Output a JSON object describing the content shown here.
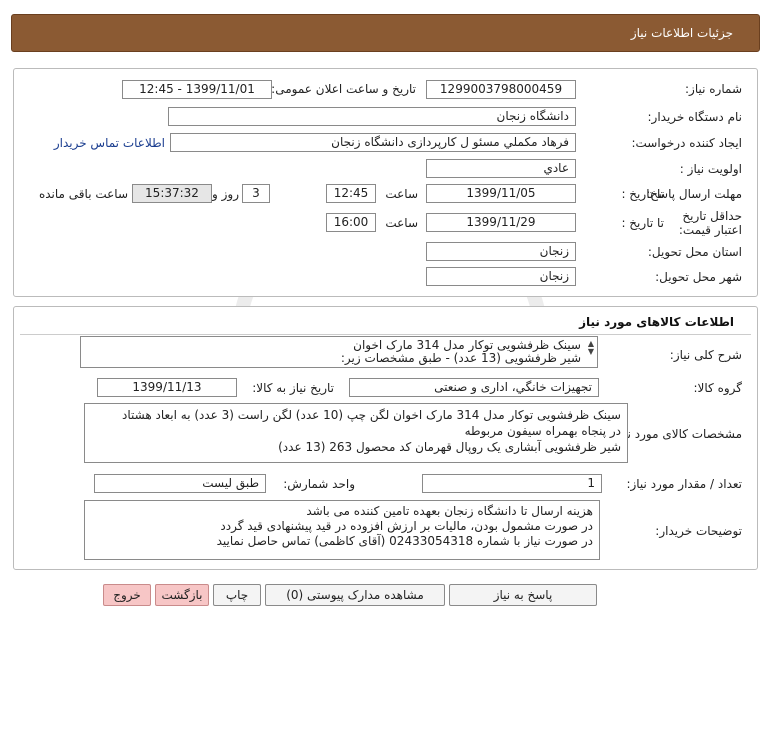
{
  "header": {
    "title": "جزئیات اطلاعات نیاز"
  },
  "info": {
    "need_number_label": "شماره نیاز:",
    "need_number": "1299003798000459",
    "announce_label": "تاریخ و ساعت اعلان عمومی:",
    "announce_value": "1399/11/01 - 12:45",
    "buyer_org_label": "نام دستگاه خریدار:",
    "buyer_org": "دانشگاه زنجان",
    "requester_label": "ایجاد کننده درخواست:",
    "requester": "فرهاد مکملي مسئو ل کارپردازی دانشگاه زنجان",
    "contact_link": "اطلاعات تماس خریدار",
    "priority_label": "اولویت نیاز :",
    "priority": "عادي",
    "send_deadline_label": "مهلت ارسال پاسخ:",
    "until_date_label": "تا تاریخ :",
    "send_date": "1399/11/05",
    "time_label": "ساعت",
    "send_time": "12:45",
    "days_value": "3",
    "days_label": "روز و",
    "remaining_time": "15:37:32",
    "remaining_label": "ساعت باقی مانده",
    "validity_label": "حداقل تاریخ اعتبار قیمت:",
    "validity_date": "1399/11/29",
    "validity_time": "16:00",
    "province_label": "استان محل تحویل:",
    "province": "زنجان",
    "city_label": "شهر محل تحویل:",
    "city": "زنجان"
  },
  "goods": {
    "section_title": "اطلاعات کالاهای مورد نیاز",
    "general_desc_label": "شرح کلی نیاز:",
    "general_desc_lines": [
      "سینک ظرفشویی توکار مدل 314 مارک اخوان",
      "شیر ظرفشویی (13 عدد) - طبق مشخصات زیر:"
    ],
    "group_label": "گروه کالا:",
    "group_value": "تجهیزات خانگي، اداری و صنعتی",
    "need_date_label": "تاریخ نیاز به کالا:",
    "need_date": "1399/11/13",
    "spec_label": "مشخصات کالای مورد نیاز:",
    "spec_lines": [
      "سینک ظرفشویی توکار مدل 314 مارک اخوان لگن چپ (10 عدد) لگن راست (3 عدد) به ابعاد هشتاد",
      "در پنجاه بهمراه سیفون مربوطه",
      "شیر ظرفشویی آبشاری یک روپال قهرمان کد محصول 263 (13 عدد)"
    ],
    "qty_label": "تعداد / مقدار مورد نیاز:",
    "qty_value": "1",
    "unit_label": "واحد شمارش:",
    "unit_value": "طبق لیست",
    "buyer_notes_label": "توضیحات خریدار:",
    "buyer_notes_lines": [
      "هزینه ارسال تا دانشگاه زنجان بعهده تامین کننده می باشد",
      "در صورت مشمول بودن، مالیات بر ارزش افزوده در قید پیشنهادی قید گردد",
      "در صورت نیاز با شماره 02433054318 (آقای کاظمی) تماس حاصل نمایید"
    ]
  },
  "buttons": {
    "reply": "پاسخ به نیاز",
    "attachments": "مشاهده مدارک پیوستی (0)",
    "print": "چاپ",
    "back": "بازگشت",
    "exit": "خروج"
  },
  "watermark": {
    "brand": "ParsNamadData",
    "caption": "پایگاه اطلاع رسانی مناقصه و مزایده"
  }
}
